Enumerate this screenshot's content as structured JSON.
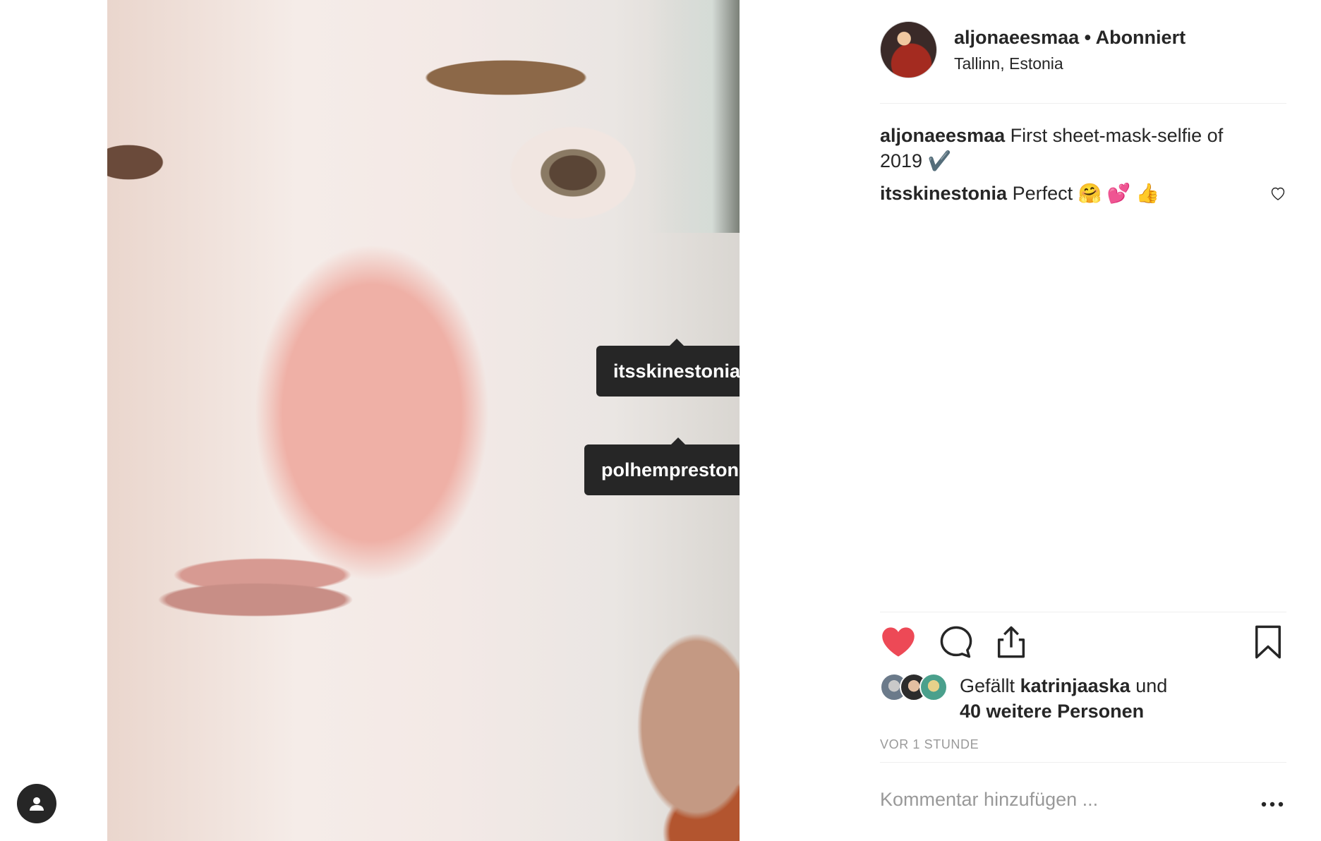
{
  "photo": {
    "tags": [
      "itsskinestonia",
      "polhemprestonia"
    ]
  },
  "post": {
    "username": "aljonaeesmaa",
    "separator": "•",
    "follow_status": "Abonniert",
    "location": "Tallinn, Estonia",
    "caption_user": "aljonaeesmaa",
    "caption_text": "First sheet-mask-selfie of 2019 ✔️",
    "comments": [
      {
        "user": "itsskinestonia",
        "text": "Perfect 🤗 💕 👍"
      }
    ],
    "likes": {
      "prefix": "Gefällt",
      "user": "katrinjaaska",
      "connector": "und",
      "others": "40 weitere Personen"
    },
    "timestamp": "VOR 1 STUNDE",
    "comment_placeholder": "Kommentar hinzufügen ...",
    "liked": true
  },
  "icons": {
    "like": "heart-filled-icon",
    "comment": "speech-bubble-icon",
    "share": "share-icon",
    "save": "bookmark-icon",
    "more": "more-dots-icon",
    "account": "person-icon"
  },
  "colors": {
    "like_red": "#ed4956",
    "text": "#262626",
    "muted": "#999999",
    "tag_bg": "#262626"
  }
}
